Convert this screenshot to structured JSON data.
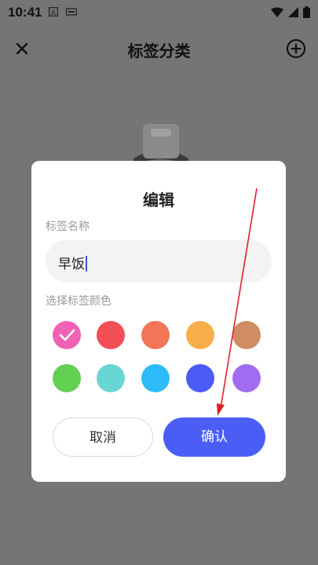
{
  "status": {
    "time": "10:41"
  },
  "appbar": {
    "title": "标签分类",
    "close_icon": "close-icon",
    "add_icon": "add-circle-icon"
  },
  "dialog": {
    "title": "编辑",
    "name_label": "标签名称",
    "name_value": "早饭",
    "color_label": "选择标签颜色",
    "colors": [
      "#f062b6",
      "#f24e55",
      "#f27557",
      "#f9ad4a",
      "#d08c62",
      "#63cf53",
      "#6ad6d4",
      "#2dbbfa",
      "#4a5cf5",
      "#a26cf0"
    ],
    "selected_color_index": 0,
    "cancel_label": "取消",
    "confirm_label": "确认"
  },
  "accent": "#4a5ef5"
}
